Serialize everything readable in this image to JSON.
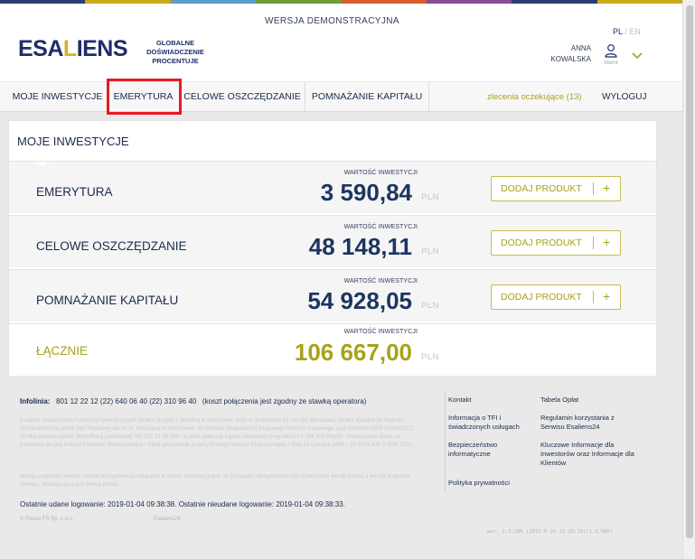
{
  "colors": {
    "navy": "#1b2b4a",
    "gold": "#a8a21a",
    "logo_blue": "#1f2d6a",
    "logo_gold": "#d8b21f",
    "highlight_red": "#e51b24",
    "top_stripe": [
      "#2e3d74",
      "#c9a91a",
      "#5e9cc9",
      "#6d9f3a",
      "#d6602a",
      "#8a4c99",
      "#2e3d74",
      "#c9a91a"
    ]
  },
  "header": {
    "demo_label": "WERSJA DEMONSTRACYJNA",
    "logo_part1": "ESA",
    "logo_part2": "L",
    "logo_part3": "IENS",
    "tagline": "GLOBALNE DOŚWIADCZENIE PROCENTUJE",
    "lang_active": "PL",
    "lang_separator": "/",
    "lang_other": "EN",
    "user_first": "ANNA",
    "user_last": "KOWALSKA",
    "user_role": "klient",
    "user_icon": "user-icon",
    "dropdown_icon": "chevron-down-icon"
  },
  "nav": {
    "items": [
      {
        "label": "MOJE INWESTYCJE"
      },
      {
        "label": "EMERYTURA"
      },
      {
        "label": "CELOWE OSZCZĘDZANIE"
      },
      {
        "label": "POMNAŻANIE KAPITAŁU"
      }
    ],
    "pending": "zlecenia oczekujące (13)",
    "logout": "WYLOGUJ"
  },
  "panel": {
    "title": "MOJE INWESTYCJE",
    "value_label": "WARTOŚĆ INWESTYCJI",
    "currency": "PLN",
    "add_label": "DODAJ PRODUKT",
    "plus": "+",
    "rows": [
      {
        "name": "EMERYTURA",
        "amount": "3 590,84"
      },
      {
        "name": "CELOWE OSZCZĘDZANIE",
        "amount": "48 148,11"
      },
      {
        "name": "POMNAŻANIE KAPITAŁU",
        "amount": "54 928,05"
      }
    ],
    "total": {
      "name": "ŁĄCZNIE",
      "amount": "106 667,00"
    }
  },
  "footer": {
    "infolinia_label": "Infolinia:",
    "infolinia_numbers": "801 12 22 12   (22) 640 06 40   (22) 310 96 40",
    "infolinia_note": "(koszt połączenia jest zgodny ze stawką operatora)",
    "legal": "Esaliens Towarzystwo Funduszy Inwestycyjnych Spółka Akcyjna z siedzibą w Warszawie, przy ul. Bielańskiej 12, 00-085 Warszawa, spółka wpisana do Rejestru Przedsiębiorców przez Sąd Rejonowy dla m. st. Warszawy w Warszawie, XII Wydział Gospodarczy Krajowego Rejestru Sądowego, pod numerem KRS 0000002717. Spółka posiada numer identyfikacji podatkowej NIP 527 21 58 048 i w pełni opłacony kapitał zakładowy w wysokości 1 258 300 złotych. Towarzystwo działa na podstawie decyzji Komisji Papierów Wartościowych i Giełd (poprzednik prawny Komisji Nadzoru Finansowego) z dnia 18 czerwca 1998 r. (nr DFN-409-3-9/98-1511).",
    "legal2": "Wersja angielska serwisu została przygotowana wyłącznie w celach informacyjnych. W przypadku niezgodności czy rozbieżności wersja polska a wersja angielska serwisu, obowiązująca jest wersja polska.",
    "last_login": "Ostatnie udane logowanie: 2019-01-04 09:38:38. Ostatnie nieudane logowanie: 2019-01-04 09:38:33.",
    "copyright": "© Pekao FS Sp. z o.o.",
    "app_name": "Esaliens24",
    "links_col1": [
      "Kontakt",
      "Informacja o TFI i świadczonych usługach",
      "Bezpieczeństwo informatyczne",
      "Polityka prywatności"
    ],
    "links_col2": [
      "Tabela Opłat",
      "Regulamin korzystania z Serwisu Esaliens24",
      "Kluczowe Informacje dla Inwestorów oraz Informacje dla Klientów"
    ],
    "version": "wer. 1.3.186 (2017-6-26 13:10:10)(1.3.086)"
  }
}
